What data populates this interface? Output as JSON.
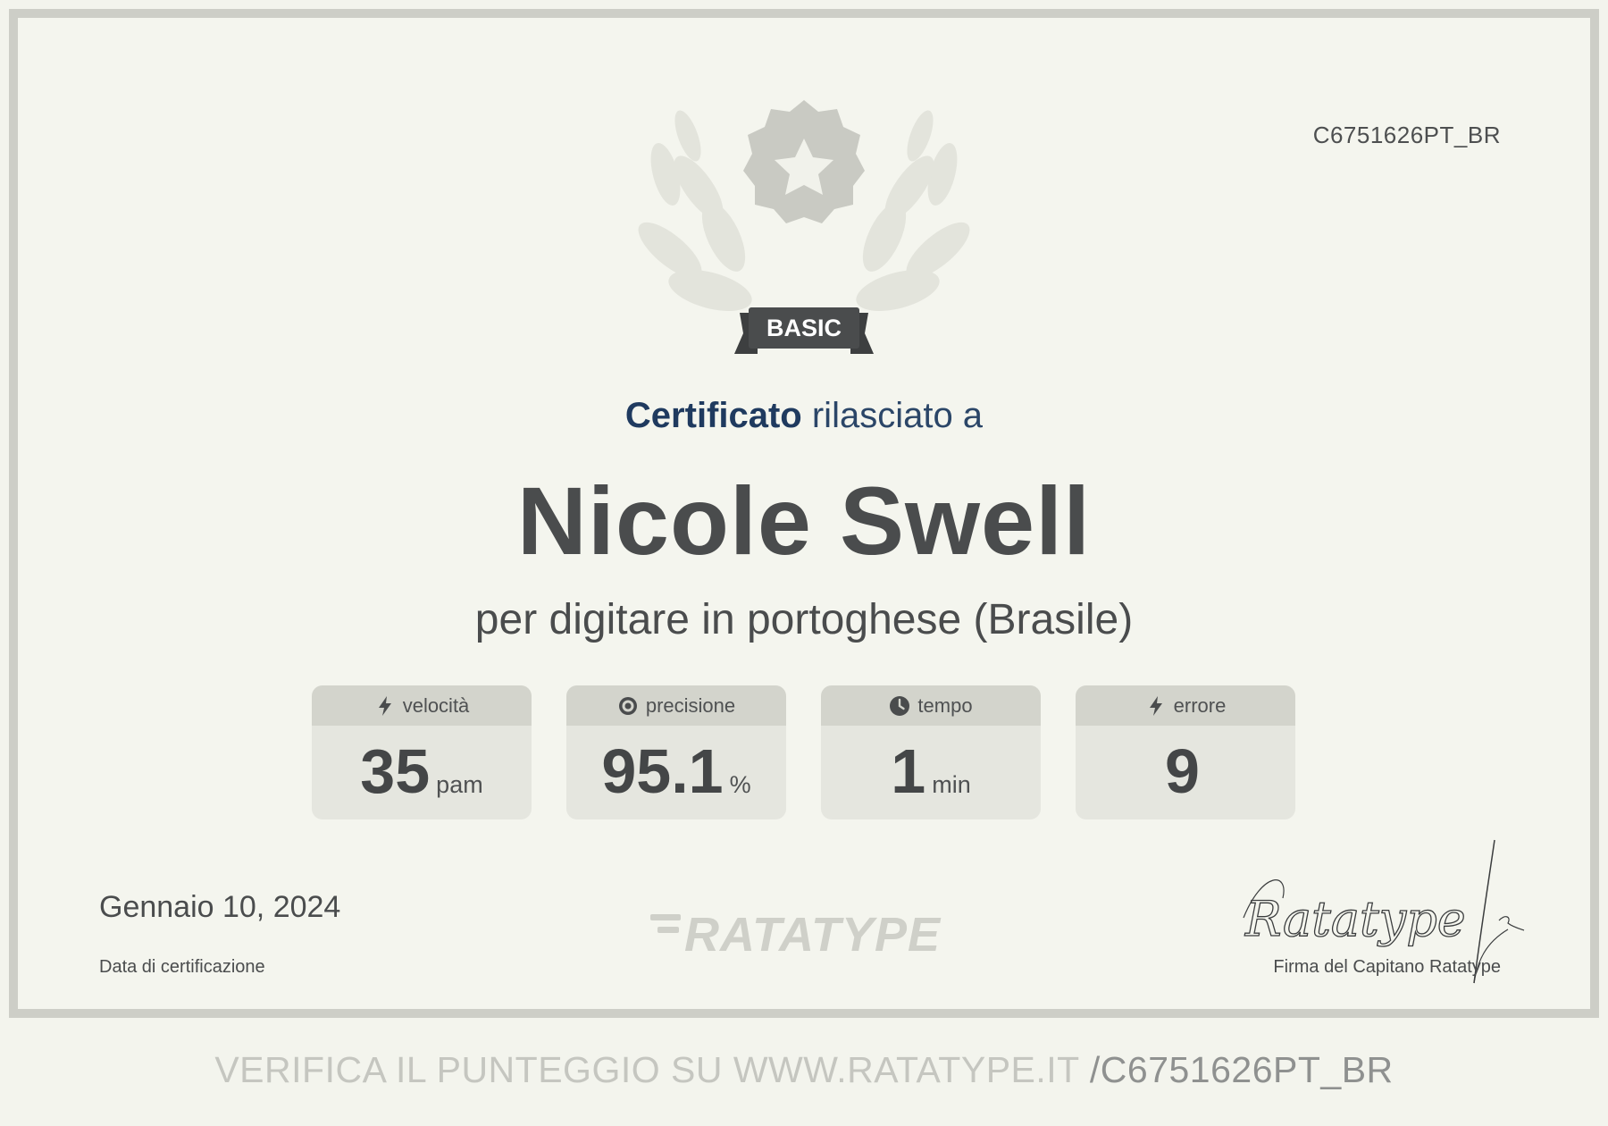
{
  "certificate": {
    "id": "C6751626PT_BR",
    "level": "BASIC",
    "heading_strong": "Certificato",
    "heading_rest": "rilasciato a",
    "name": "Nicole Swell",
    "subtitle": "per digitare in portoghese (Brasile)"
  },
  "stats": [
    {
      "label": "velocità",
      "value": "35",
      "unit": "pam",
      "icon": "lightning-icon"
    },
    {
      "label": "precisione",
      "value": "95.1",
      "unit": "%",
      "icon": "target-icon"
    },
    {
      "label": "tempo",
      "value": "1",
      "unit": "min",
      "icon": "clock-icon"
    },
    {
      "label": "errore",
      "value": "9",
      "unit": "",
      "icon": "lightning-icon"
    }
  ],
  "footer": {
    "date": "Gennaio 10, 2024",
    "date_label": "Data di certificazione",
    "logo_text": "RATATYPE",
    "signature_text": "Ratatype",
    "signature_label": "Firma del Capitano Ratatype"
  },
  "verify": {
    "prefix": "VERIFICA IL PUNTEGGIO SU WWW.RATATYPE.IT",
    "code": "/C6751626PT_BR"
  },
  "colors": {
    "background": "#f4f5ee",
    "border": "#cdcec7",
    "heading_blue": "#1f3a5f",
    "text_dark": "#4a4c4d",
    "badge": "#4a4c4d"
  }
}
